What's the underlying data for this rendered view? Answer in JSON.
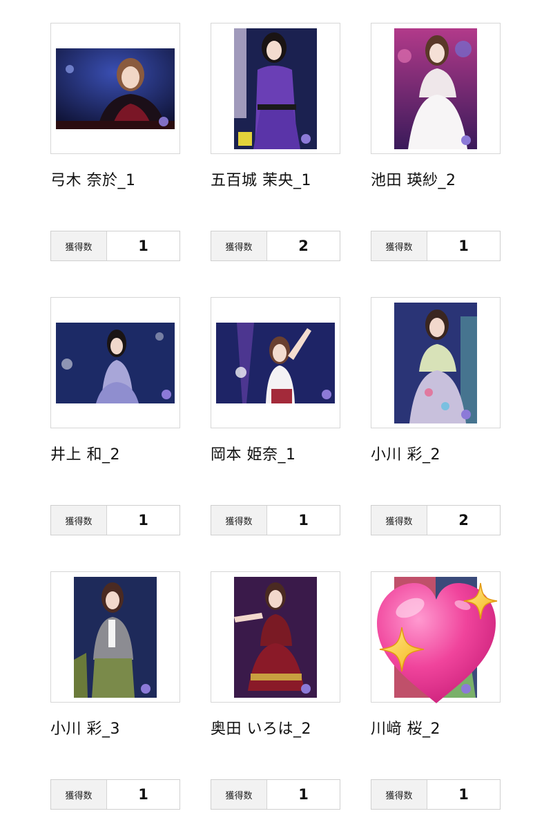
{
  "cards": [
    {
      "name": "弓木 奈於_1",
      "count_label": "獲得数",
      "count": "1",
      "photo": "concert-photo-landscape-red-outfit"
    },
    {
      "name": "五百城 茉央_1",
      "count_label": "獲得数",
      "count": "2",
      "photo": "concert-photo-portrait-purple-outfit"
    },
    {
      "name": "池田 瑛紗_2",
      "count_label": "獲得数",
      "count": "1",
      "photo": "concert-photo-portrait-white-dress"
    },
    {
      "name": "井上 和_2",
      "count_label": "獲得数",
      "count": "1",
      "photo": "concert-photo-landscape-lavender-dress"
    },
    {
      "name": "岡本 姫奈_1",
      "count_label": "獲得数",
      "count": "1",
      "photo": "concert-photo-landscape-arm-raised"
    },
    {
      "name": "小川 彩_2",
      "count_label": "獲得数",
      "count": "2",
      "photo": "concert-photo-portrait-floral-dress"
    },
    {
      "name": "小川 彩_3",
      "count_label": "獲得数",
      "count": "1",
      "photo": "concert-photo-portrait-gray-blazer"
    },
    {
      "name": "奥田 いろは_2",
      "count_label": "獲得数",
      "count": "1",
      "photo": "concert-photo-portrait-burgundy-dress"
    },
    {
      "name": "川﨑 桜_2",
      "count_label": "獲得数",
      "count": "1",
      "photo": "concert-photo-portrait-covered"
    }
  ],
  "overlay": {
    "icon": "sparkling-heart-icon",
    "color": "#f0449c"
  }
}
